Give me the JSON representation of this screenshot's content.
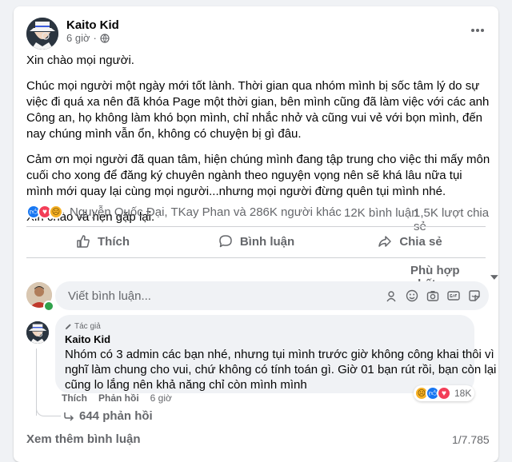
{
  "post": {
    "author": "Kaito Kid",
    "time": "6 giờ",
    "privacy_icon": "globe-icon",
    "more_icon": "more-dots-icon",
    "paragraphs": [
      "Xin chào mọi người.",
      "Chúc mọi người một ngày mới tốt lành. Thời gian qua nhóm mình bị sốc tâm lý do sự việc đi quá xa nên đã khóa Page một thời gian, bên mình cũng đã làm việc với các anh Công an, họ không làm khó bọn mình, chỉ nhắc nhở và cũng vui vẻ với bọn mình, đến nay chúng mình vẫn ổn, không có chuyện bị gì đâu.",
      "Cảm ơn mọi người đã quan tâm, hiện chúng mình đang tập trung cho việc thi mấy môn cuối cho xong để đăng ký chuyên ngành theo nguyện vọng nên sẽ khá lâu nữa tụi mình mới quay lại cùng mọi người...nhưng mọi người đừng quên tụi mình nhé.",
      "Xin chào và hẹn gặp lại."
    ]
  },
  "reactions": {
    "icons": [
      "like-reaction-icon",
      "love-reaction-icon",
      "sad-reaction-icon"
    ],
    "names": "Nguyễn Quốc Đại, TKay Phan và 286K người khác",
    "comments": "12K bình luận",
    "shares": "1,5K lượt chia sẻ"
  },
  "actions": {
    "like": "Thích",
    "comment": "Bình luận",
    "share": "Chia sẻ"
  },
  "sort": {
    "label": "Phù hợp nhất"
  },
  "composer": {
    "placeholder": "Viết bình luận..."
  },
  "comment": {
    "badge": "Tác giả",
    "author": "Kaito Kid",
    "lines": [
      "Nhóm có 3 admin các bạn nhé, nhưng tụi mình trước giờ không công khai thôi vì",
      "nghĩ làm chung cho vui, chứ không có tính toán gì. Giờ 01 bạn rút rồi, bạn còn lại",
      "cũng lo lắng nên khả năng chỉ còn mình mình"
    ],
    "like": "Thích",
    "reply": "Phản hồi",
    "time": "6 giờ",
    "reaction_count": "18K",
    "replies": "644 phản hồi"
  },
  "footer": {
    "more": "Xem thêm bình luận",
    "count": "1/7.785"
  },
  "colors": {
    "like": "#1877f2",
    "love": "#f33e58",
    "sad": "#f7b125",
    "muted": "#65676b",
    "online": "#31a24c"
  }
}
